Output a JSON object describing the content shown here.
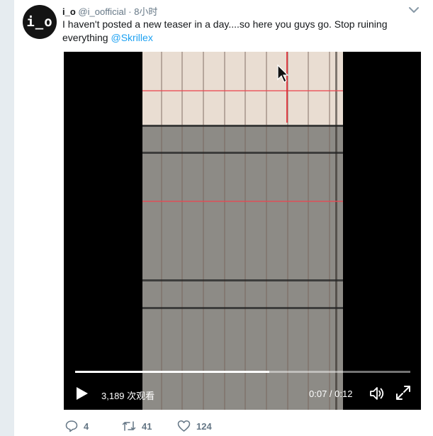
{
  "tweet": {
    "avatar_text": "i_o",
    "display_name": "i_o",
    "handle": "@i_oofficial",
    "separator": "·",
    "timestamp": "8小时",
    "text_line1": "I haven't posted a new teaser in a day....so here you guys go. Stop ruining",
    "text_line2": "everything ",
    "mention": "@Skrillex"
  },
  "video": {
    "views": "3,189 次观看",
    "timecode": "0:07 / 0:12",
    "progress": 0.58
  },
  "actions": {
    "reply_count": "4",
    "retweet_count": "41",
    "like_count": "124"
  },
  "icons": {
    "more": "chevron-down-icon",
    "play": "play-icon",
    "volume": "volume-icon",
    "fullscreen": "fullscreen-icon",
    "reply": "reply-icon",
    "retweet": "retweet-icon",
    "like": "heart-icon"
  },
  "colors": {
    "link": "#1da1f2",
    "muted": "#657786",
    "page_background": "#e6ecf0"
  }
}
